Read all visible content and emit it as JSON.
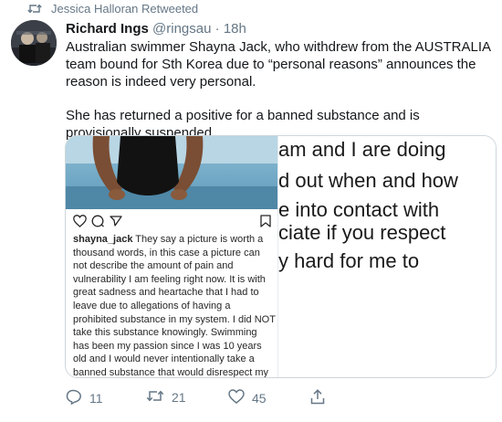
{
  "retweet": {
    "icon": "retweet-icon",
    "text": "Jessica Halloran Retweeted"
  },
  "tweet": {
    "author_name": "Richard Ings",
    "handle": "@ringsau",
    "separator": "·",
    "time": "18h",
    "paragraphs": [
      "Australian swimmer Shayna Jack, who withdrew from the AUSTRALIA team bound for Sth Korea due to “personal reasons” announces the reason is indeed very personal.",
      "She has returned a positive for a banned substance and is provisionally suspended."
    ]
  },
  "instagram_post": {
    "username": "shayna_jack",
    "caption": "They say a picture is worth a thousand words, in this case a picture can not describe the amount of pain and vulnerability I am feeling right now. It is with great sadness and heartache that I had to leave due to allegations of having a prohibited substance in my system. I did NOT take this substance knowingly. Swimming has been my passion since I was 10 years old and I would never intentionally take a banned substance that would disrespect my sport and jeopardise my"
  },
  "notes_crop": {
    "lines": [
      "am and I are doing",
      "d out when and how",
      "e into contact with",
      "ciate if you respect",
      "y hard for me to"
    ]
  },
  "actions": {
    "reply_count": "11",
    "retweet_count": "21",
    "like_count": "45"
  },
  "colors": {
    "text": "#14171a",
    "muted": "#657786",
    "border": "#ccd6dd"
  }
}
